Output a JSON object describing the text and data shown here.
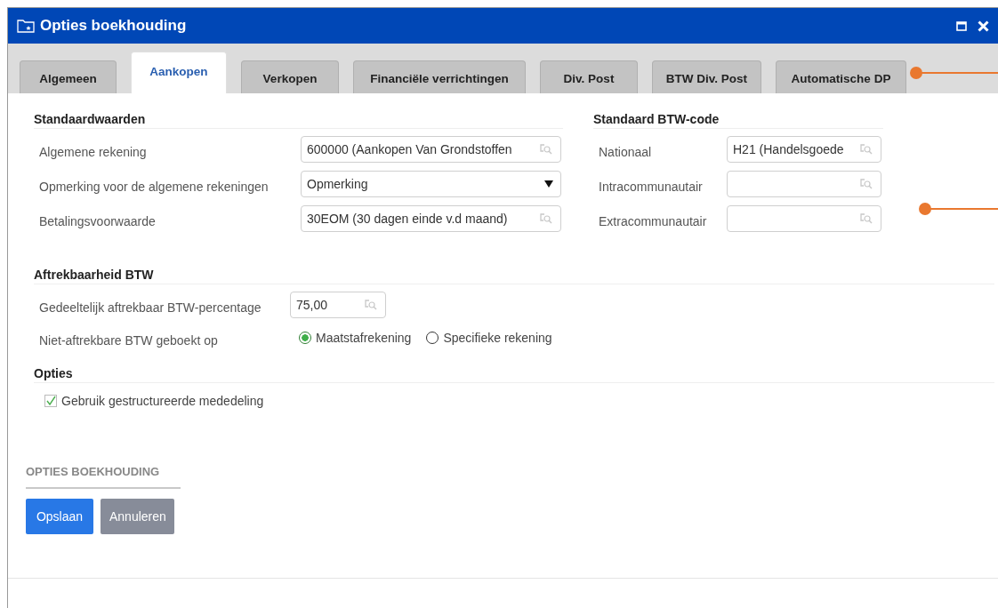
{
  "window": {
    "title": "Opties boekhouding"
  },
  "tabs": [
    {
      "label": "Algemeen",
      "selected": false
    },
    {
      "label": "Aankopen",
      "selected": true
    },
    {
      "label": "Verkopen",
      "selected": false
    },
    {
      "label": "Financiële verrichtingen",
      "selected": false
    },
    {
      "label": "Div. Post",
      "selected": false
    },
    {
      "label": "BTW Div. Post",
      "selected": false
    },
    {
      "label": "Automatische DP",
      "selected": false
    }
  ],
  "sections": [
    {
      "title": "Standaardwaarden",
      "fields": [
        {
          "kind": "lookup",
          "label": "Algemene rekening",
          "value": "600000 (Aankopen Van Grondstoffen"
        },
        {
          "kind": "select",
          "label": "Opmerking voor de algemene rekeningen",
          "value": "Opmerking"
        },
        {
          "kind": "lookup",
          "label": "Betalingsvoorwaarde",
          "value": "30EOM (30 dagen einde v.d maand)"
        }
      ]
    },
    {
      "title": "Standaard BTW-code",
      "fields": [
        {
          "kind": "lookup",
          "label": "Nationaal",
          "value": "H21 (Handelsgoede"
        },
        {
          "kind": "lookup",
          "label": "Intracommunautair"
        },
        {
          "kind": "lookup",
          "label": "Extracommunautair"
        }
      ]
    }
  ],
  "deductibility": {
    "title": "Aftrekbaarheid BTW",
    "percentage": {
      "label": "Gedeeltelijk aftrekbaar BTW-percentage",
      "value": "75,00"
    },
    "booked_on": {
      "label": "Niet-aftrekbare BTW geboekt op",
      "options": [
        {
          "label": "Maatstafrekening",
          "selected": true
        },
        {
          "label": "Specifieke rekening",
          "selected": false
        }
      ]
    }
  },
  "options": {
    "title": "Opties",
    "items": [
      {
        "label": "Gebruik gestructureerde mededeling",
        "checked": true
      }
    ]
  },
  "footer": {
    "title": "OPTIES BOEKHOUDING",
    "buttons": [
      {
        "label": "Opslaan",
        "kind": "primary"
      },
      {
        "label": "Annuleren",
        "kind": "secondary"
      }
    ]
  }
}
